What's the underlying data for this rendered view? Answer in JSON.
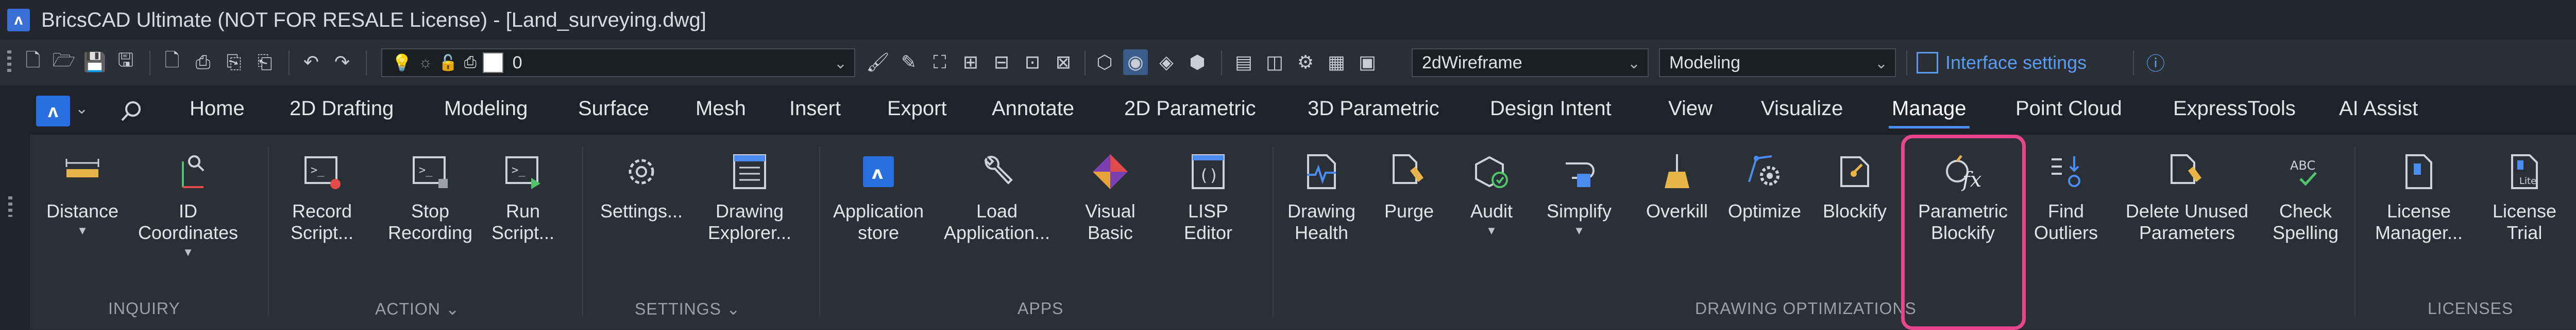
{
  "window": {
    "title": "BricsCAD Ultimate (NOT FOR RESALE License) - [Land_surveying.dwg]"
  },
  "quick_access": {
    "layer_value": "0",
    "visual_style": "2dWireframe",
    "workspace": "Modeling",
    "interface_settings": "Interface settings"
  },
  "tabs": [
    {
      "label": "Home"
    },
    {
      "label": "2D Drafting"
    },
    {
      "label": "Modeling"
    },
    {
      "label": "Surface"
    },
    {
      "label": "Mesh"
    },
    {
      "label": "Insert"
    },
    {
      "label": "Export"
    },
    {
      "label": "Annotate"
    },
    {
      "label": "2D Parametric"
    },
    {
      "label": "3D Parametric"
    },
    {
      "label": "Design Intent"
    },
    {
      "label": "View"
    },
    {
      "label": "Visualize"
    },
    {
      "label": "Manage"
    },
    {
      "label": "Point Cloud"
    },
    {
      "label": "ExpressTools"
    },
    {
      "label": "AI Assist"
    }
  ],
  "ribbon": {
    "inquiry": {
      "label": "INQUIRY",
      "distance": "Distance",
      "id_coordinates_1": "ID",
      "id_coordinates_2": "Coordinates"
    },
    "action": {
      "label": "ACTION",
      "record_1": "Record",
      "record_2": "Script...",
      "stop_1": "Stop",
      "stop_2": "Recording",
      "run_1": "Run",
      "run_2": "Script..."
    },
    "settings": {
      "label": "SETTINGS",
      "settings": "Settings...",
      "explorer_1": "Drawing",
      "explorer_2": "Explorer..."
    },
    "apps": {
      "label": "APPS",
      "store_1": "Application",
      "store_2": "store",
      "load_1": "Load",
      "load_2": "Application...",
      "vb_1": "Visual",
      "vb_2": "Basic",
      "lisp_1": "LISP",
      "lisp_2": "Editor"
    },
    "optimization": {
      "label": "DRAWING OPTIMIZATIONS",
      "health_1": "Drawing",
      "health_2": "Health",
      "purge": "Purge",
      "audit": "Audit",
      "simplify": "Simplify",
      "overkill": "Overkill",
      "optimize": "Optimize",
      "blockify": "Blockify",
      "pblockify_1": "Parametric",
      "pblockify_2": "Blockify",
      "outliers_1": "Find",
      "outliers_2": "Outliers",
      "unused_1": "Delete Unused",
      "unused_2": "Parameters",
      "spell_1": "Check",
      "spell_2": "Spelling",
      "spell_icon_text": "ABC"
    },
    "licenses": {
      "label": "LICENSES",
      "manager_1": "License",
      "manager_2": "Manager...",
      "trial_1": "License",
      "trial_2": "Trial",
      "trial_icon_text": "Lite"
    }
  },
  "colors": {
    "accent": "#4a8cf0",
    "highlight": "#e8458a",
    "background": "#2b2f36"
  }
}
